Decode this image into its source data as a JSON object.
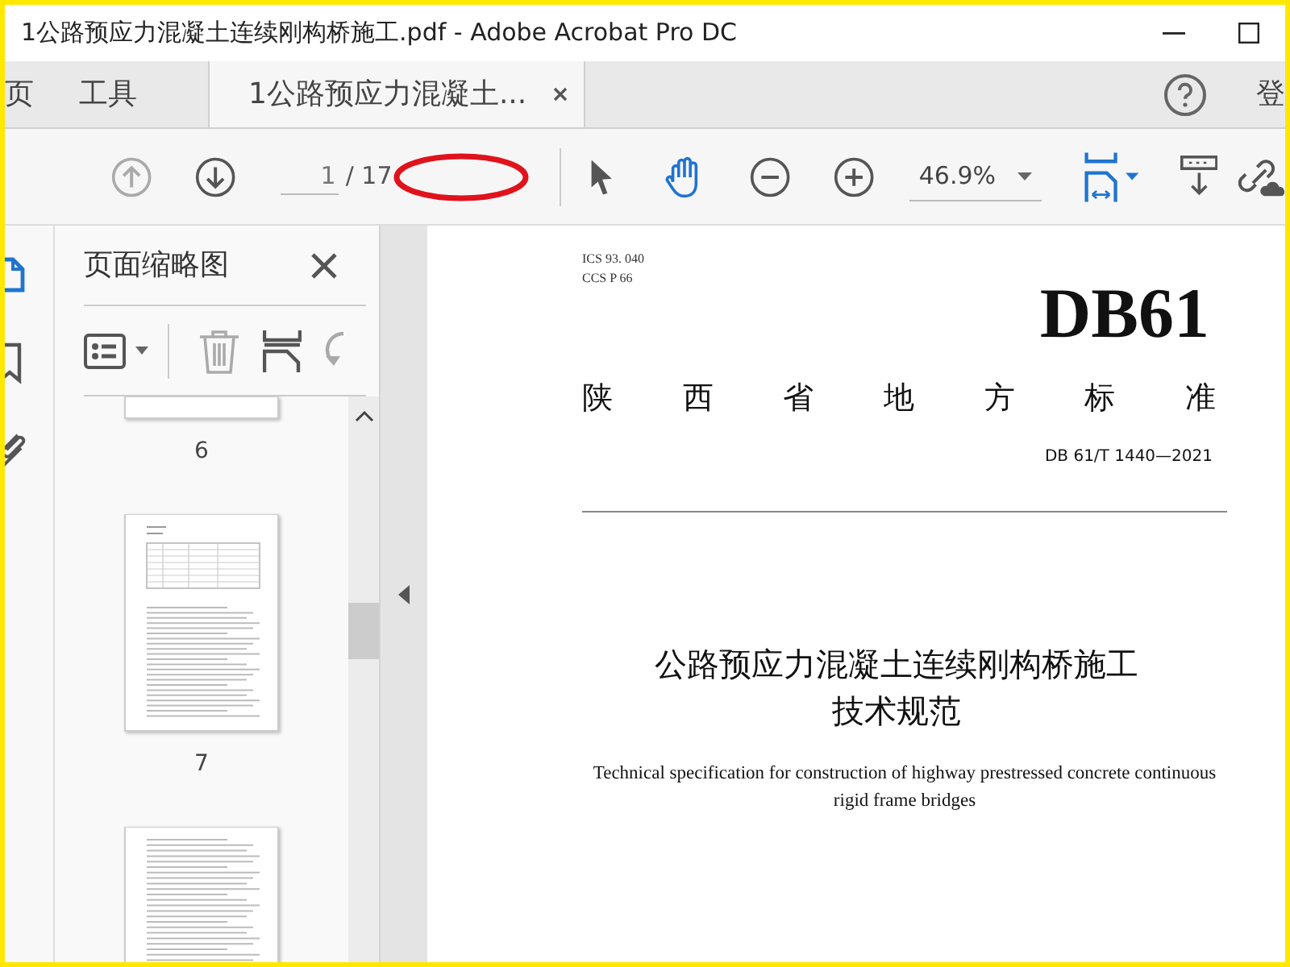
{
  "window": {
    "title": "1公路预应力混凝土连续刚构桥施工.pdf - Adobe Acrobat Pro DC"
  },
  "tabs": [
    {
      "label": "页",
      "selected": false,
      "closable": false
    },
    {
      "label": "工具",
      "selected": false,
      "closable": false
    },
    {
      "label": "1公路预应力混凝土...",
      "selected": true,
      "closable": true
    }
  ],
  "account": {
    "signin": "登"
  },
  "toolbar": {
    "prev_disabled": true,
    "next_disabled": false,
    "page": "1",
    "total": "/ 17",
    "zoom": "46.9%",
    "page_highlighted": true
  },
  "left_rail": [
    {
      "kind": "thumbnails",
      "selected": true
    },
    {
      "kind": "bookmarks",
      "selected": false
    },
    {
      "kind": "attachments",
      "selected": false
    }
  ],
  "panel": {
    "title": "页面缩略图",
    "trash_disabled": true,
    "rotate_disabled": true,
    "thumbnails": [
      {
        "kind": "partial",
        "label": "6",
        "selected": false
      },
      {
        "kind": "table",
        "label": "7",
        "selected": false
      },
      {
        "kind": "text",
        "selected": false
      }
    ]
  },
  "document": {
    "codes": [
      "ICS 93. 040",
      "CCS P 66"
    ],
    "logo": "DB61",
    "standard_type": [
      "陕",
      "西",
      "省",
      "地",
      "方",
      "标",
      "准"
    ],
    "number": "DB 61/T 1440—2021",
    "title_lines": [
      "公路预应力混凝土连续刚构桥施工",
      "技术规范"
    ],
    "english_lines": [
      "Technical specification for construction of highway prestressed concrete continuous",
      "rigid frame bridges"
    ]
  }
}
